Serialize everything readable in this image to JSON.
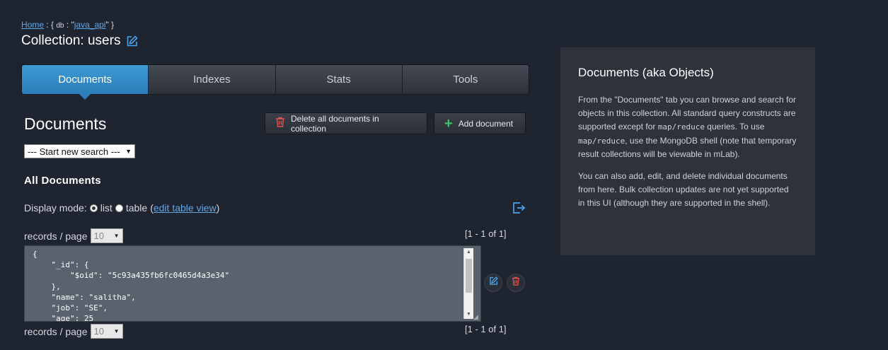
{
  "breadcrumb": {
    "home": "Home",
    "sep": " : { ",
    "db_key": "db",
    "db_sep": " : \"",
    "db_name": "java_api",
    "close": "\" }"
  },
  "title": "Collection: users",
  "tabs": [
    {
      "label": "Documents",
      "active": true
    },
    {
      "label": "Indexes",
      "active": false
    },
    {
      "label": "Stats",
      "active": false
    },
    {
      "label": "Tools",
      "active": false
    }
  ],
  "documents": {
    "heading": "Documents",
    "delete_all_label": "Delete all documents in collection",
    "add_label": "Add document",
    "search_select": "--- Start new search ---",
    "all_heading": "All Documents",
    "display_mode": {
      "label": "Display mode:",
      "list": "list",
      "table": "table",
      "open_paren": "(",
      "edit_table_view": "edit table view",
      "close_paren": ")",
      "selected": "list"
    },
    "records_per_page_label": "records / page",
    "records_per_page_value": "10",
    "count_text": "[1 - 1 of 1]",
    "doc_lines": [
      "{",
      "    \"_id\": {",
      "        \"$oid\": \"5c93a435fb6fc0465d4a3e34\"",
      "    },",
      "    \"name\": \"salitha\",",
      "    \"job\": \"SE\",",
      "    \"age\": 25"
    ]
  },
  "panel": {
    "title": "Documents (aka Objects)",
    "p1_a": "From the \"Documents\" tab you can browse and search for objects in this collection. All standard query constructs are supported except for ",
    "p1_code1": "map/reduce",
    "p1_b": " queries. To use ",
    "p1_code2": "map/reduce",
    "p1_c": ", use the MongoDB shell (note that temporary result collections will be viewable in mLab).",
    "p2": "You can also add, edit, and delete individual documents from here. Bulk collection updates are not yet supported in this UI (although they are supported in the shell)."
  },
  "colors": {
    "background": "#1f2431",
    "accent_blue": "#2b7eb8",
    "danger_red": "#e2524a",
    "success_green": "#3ec46d",
    "panel_bg": "#2d323b"
  },
  "icons": [
    "edit-icon",
    "trash-icon",
    "plus-icon",
    "export-icon",
    "chevron-down-icon"
  ]
}
